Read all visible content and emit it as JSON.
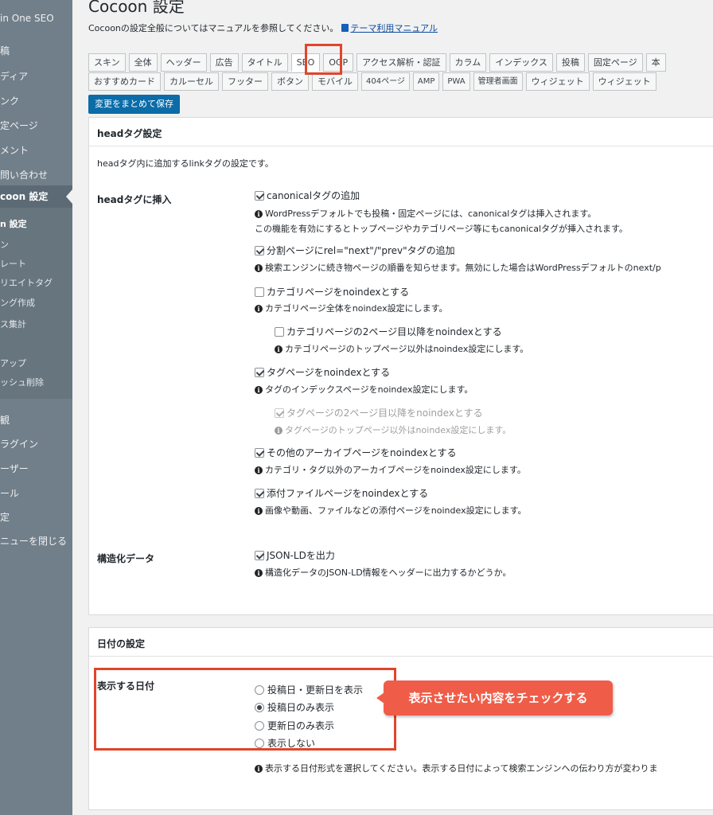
{
  "sidebar": {
    "items": [
      {
        "label": "in One SEO"
      },
      {
        "label": "稿"
      },
      {
        "label": "ディア"
      },
      {
        "label": "ンク"
      },
      {
        "label": "定ページ"
      },
      {
        "label": "メント"
      },
      {
        "label": "問い合わせ"
      },
      {
        "label": "coon 設定"
      },
      {
        "label": "n 設定"
      },
      {
        "label": "ン"
      },
      {
        "label": "レート"
      },
      {
        "label": "リエイトタグ"
      },
      {
        "label": "ング作成"
      },
      {
        "label": "ス集計"
      },
      {
        "label": "アップ"
      },
      {
        "label": "ッシュ削除"
      },
      {
        "label": "観"
      },
      {
        "label": "ラグイン"
      },
      {
        "label": "ーザー"
      },
      {
        "label": "ール"
      },
      {
        "label": "定"
      },
      {
        "label": "ニューを閉じる"
      }
    ]
  },
  "header": {
    "title": "Cocoon 設定",
    "intro_text": "Cocoonの設定全般についてはマニュアルを参照してください。",
    "manual_link": "テーマ利用マニュアル"
  },
  "tabs": {
    "row1": [
      "スキン",
      "全体",
      "ヘッダー",
      "広告",
      "タイトル",
      "SEO",
      "OGP",
      "アクセス解析・認証",
      "カラム",
      "インデックス",
      "投稿",
      "固定ページ",
      "本"
    ],
    "row2": [
      "おすすめカード",
      "カルーセル",
      "フッター",
      "ボタン",
      "モバイル",
      "404ページ",
      "AMP",
      "PWA",
      "管理者画面",
      "ウィジェット",
      "ウィジェット"
    ],
    "active": "SEO"
  },
  "save_button": "変更をまとめて保存",
  "head_section": {
    "title": "headタグ設定",
    "description": "headタグ内に追加するlinkタグの設定です。",
    "insert_label": "headタグに挿入",
    "options": [
      {
        "label": "canonicalタグの追加",
        "checked": true,
        "notes": [
          "WordPressデフォルトでも投稿・固定ページには、canonicalタグは挿入されます。",
          "この機能を有効にするとトップページやカテゴリページ等にもcanonicalタグが挿入されます。"
        ]
      },
      {
        "label": "分割ページにrel=\"next\"/\"prev\"タグの追加",
        "checked": true,
        "notes": [
          "検索エンジンに続き物ページの順番を知らせます。無効にした場合はWordPressデフォルトのnext/p"
        ]
      },
      {
        "label": "カテゴリページをnoindexとする",
        "checked": false,
        "notes": [
          "カテゴリページ全体をnoindex設定にします。"
        ]
      },
      {
        "label": "カテゴリページの2ページ目以降をnoindexとする",
        "checked": false,
        "notes": [
          "カテゴリページのトップページ以外はnoindex設定にします。"
        ]
      },
      {
        "label": "タグページをnoindexとする",
        "checked": true,
        "notes": [
          "タグのインデックスページをnoindex設定にします。"
        ]
      },
      {
        "label": "タグページの2ページ目以降をnoindexとする",
        "checked": true,
        "notes": [
          "タグページのトップページ以外はnoindex設定にします。"
        ]
      },
      {
        "label": "その他のアーカイブページをnoindexとする",
        "checked": true,
        "notes": [
          "カテゴリ・タグ以外のアーカイブページをnoindex設定にします。"
        ]
      },
      {
        "label": "添付ファイルページをnoindexとする",
        "checked": true,
        "notes": [
          "画像や動画、ファイルなどの添付ページをnoindex設定にします。"
        ]
      }
    ],
    "structured_label": "構造化データ",
    "jsonld": {
      "label": "JSON-LDを出力",
      "checked": true,
      "note": "構造化データのJSON-LD情報をヘッダーに出力するかどうか。"
    }
  },
  "date_section": {
    "title": "日付の設定",
    "display_label": "表示する日付",
    "radios": [
      {
        "label": "投稿日・更新日を表示",
        "checked": false
      },
      {
        "label": "投稿日のみ表示",
        "checked": true
      },
      {
        "label": "更新日のみ表示",
        "checked": false
      },
      {
        "label": "表示しない",
        "checked": false
      }
    ],
    "note": "表示する日付形式を選択してください。表示する日付によって検索エンジンへの伝わり方が変わりま",
    "callout": "表示させたい内容をチェックする"
  },
  "colors": {
    "highlight": "#e0452a",
    "callout": "#ef5d48",
    "sidebar": "#707f8a",
    "save_button": "#0b6ca8"
  }
}
